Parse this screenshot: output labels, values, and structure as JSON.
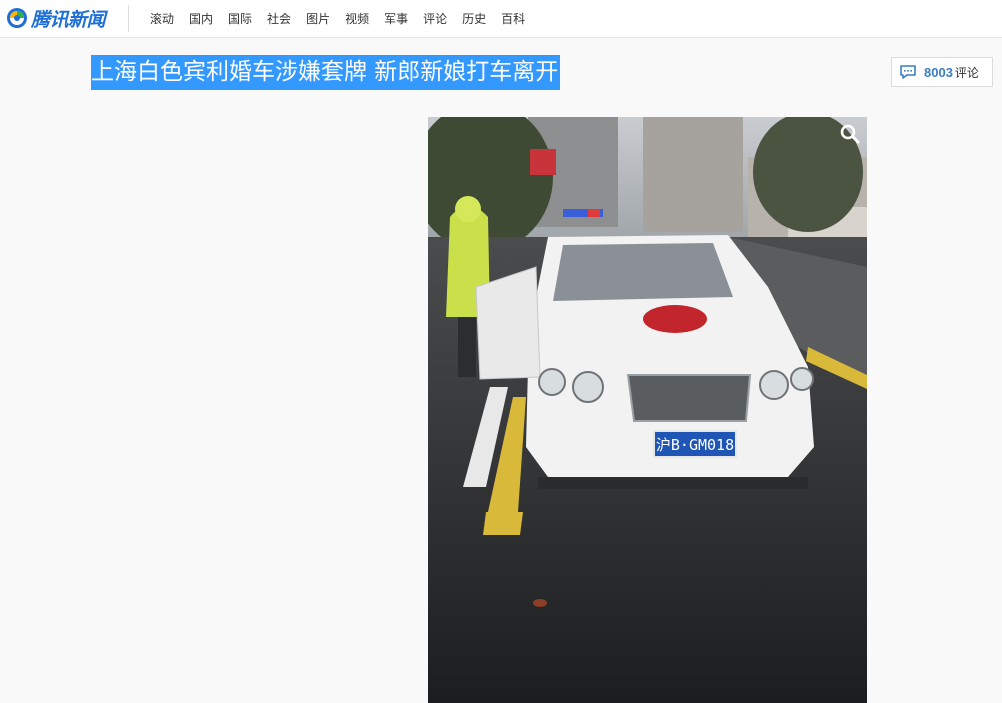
{
  "header": {
    "logo_text": "腾讯新闻",
    "nav_items": [
      {
        "label": "滚动"
      },
      {
        "label": "国内"
      },
      {
        "label": "国际"
      },
      {
        "label": "社会"
      },
      {
        "label": "图片"
      },
      {
        "label": "视频"
      },
      {
        "label": "军事"
      },
      {
        "label": "评论"
      },
      {
        "label": "历史"
      },
      {
        "label": "百科"
      }
    ]
  },
  "article": {
    "title": "上海白色宾利婚车涉嫌套牌 新郎新娘打车离开",
    "comment_count": "8003",
    "comment_label": "评论"
  },
  "photo": {
    "plate_text": "沪B·GM018",
    "icons": [
      "search-icon",
      "comment-icon"
    ]
  },
  "colors": {
    "headline_highlight": "#3399ff",
    "comment_count": "#3b7dc4",
    "logo": "#1e6fd6"
  }
}
